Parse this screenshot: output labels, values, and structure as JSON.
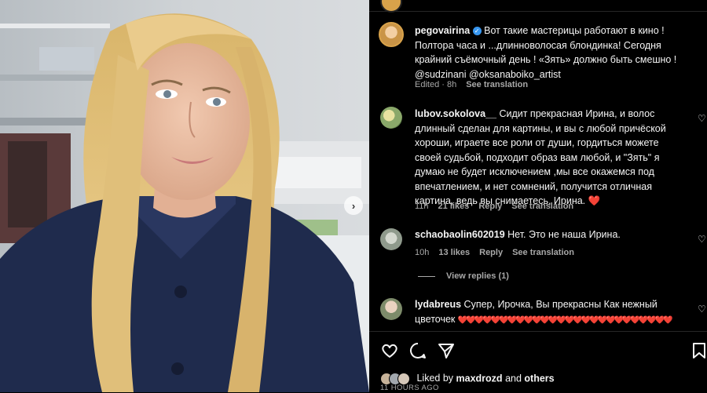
{
  "post": {
    "author": "pegovairina",
    "verified_icon": "verified-badge-icon",
    "caption_lines": [
      "Вот такие мастерицы работают в кино !",
      "Полтора часа и ...длинноволосая блондинка! Сегодня",
      "крайний съёмочный день ! «Зять» должно быть смешно !",
      "@sudzinani @oksanaboiko_artist"
    ],
    "edited": "Edited · 8h",
    "see_translation": "See translation"
  },
  "comments": [
    {
      "username": "lubov.sokolova__",
      "lines": [
        "Сидит прекрасная Ирина, и волос",
        "длинный сделан для картины, и вы с любой причёской",
        "хороши, играете все роли от души, гордиться можете",
        "своей судьбой, подходит образ вам любой, и \"Зять\" я",
        "думаю не будет исключением ,мы все окажемся под",
        "впечатлением, и нет сомнений, получится отличная",
        "картина, ведь вы снимаетесь, Ирина."
      ],
      "emoji": "❤️",
      "time": "11h",
      "likes": "21 likes",
      "reply": "Reply",
      "translation": "See translation"
    },
    {
      "username": "schaobaolin602019",
      "lines": [
        "Нет. Это не наша Ирина."
      ],
      "time": "10h",
      "likes": "13 likes",
      "reply": "Reply",
      "translation": "See translation",
      "view_replies": "View replies (1)"
    },
    {
      "username": "lydabreus",
      "lines": [
        "Супер, Ирочка, Вы прекрасны Как нежный",
        "цветочек"
      ],
      "hearts_row1": "❤️❤️❤️❤️❤️❤️❤️❤️❤️❤️❤️❤️❤️❤️❤️❤️❤️❤️❤️❤️❤️❤️❤️❤️❤️❤️",
      "hearts_row2": "❤️❤️❤️❤️❤️❤️❤️❤️❤️❤️❤️❤️"
    }
  ],
  "actions": {
    "icons": [
      "heart-icon",
      "comment-icon",
      "share-icon",
      "bookmark-icon"
    ],
    "liked_by_prefix": "Liked by",
    "liked_by_user": "maxdrozd",
    "liked_by_and": "and",
    "liked_by_others": "others",
    "time_ago": "11 HOURS AGO"
  },
  "carousel": {
    "next_icon": "chevron-right-icon"
  }
}
